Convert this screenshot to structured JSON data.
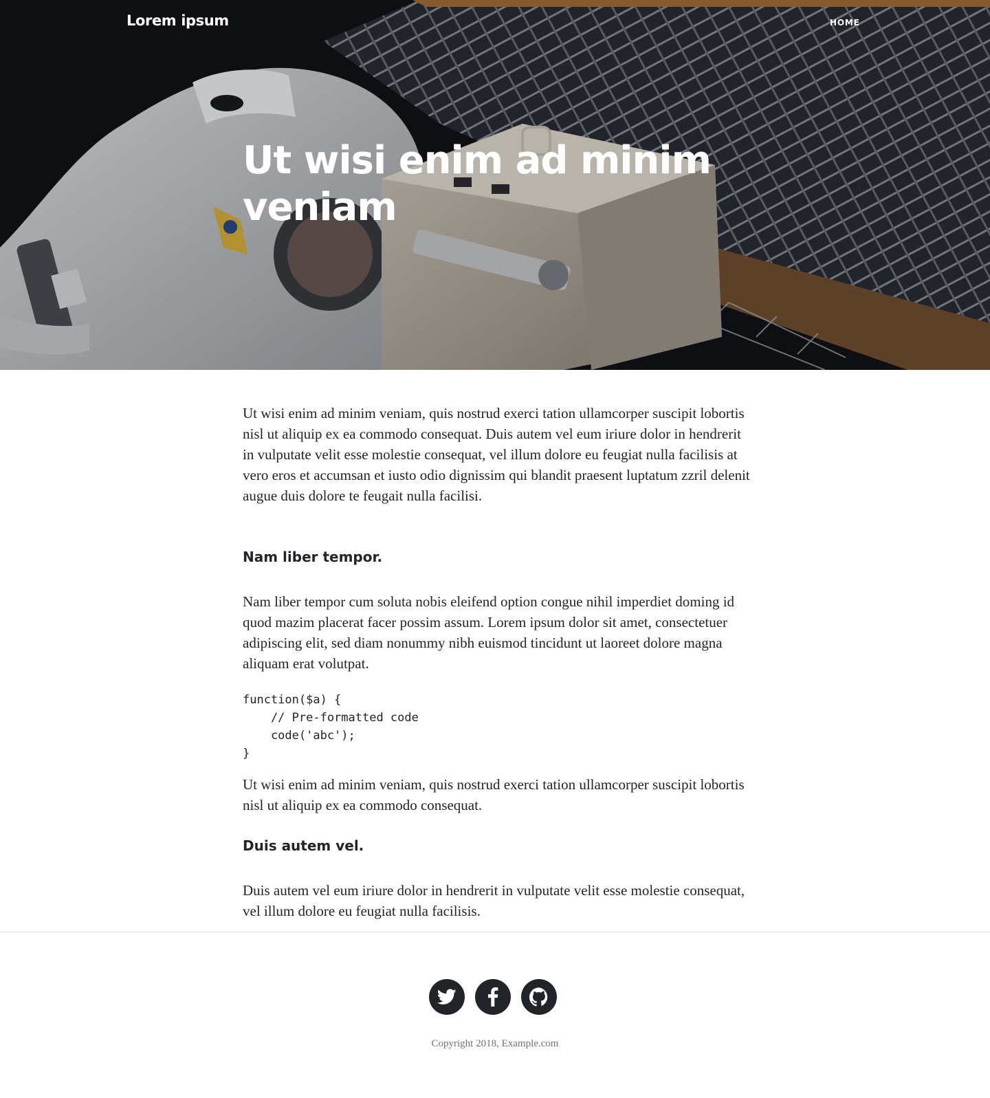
{
  "nav": {
    "brand": "Lorem ipsum",
    "home": "HOME"
  },
  "hero": {
    "title": "Ut wisi enim ad minim veniam"
  },
  "article": {
    "paragraph_1": "Ut wisi enim ad minim veniam, quis nostrud exerci tation ullamcorper suscipit lobortis nisl ut aliquip ex ea commodo consequat. Duis autem vel eum iriure dolor in hendrerit in vulputate velit esse molestie consequat, vel illum dolore eu feugiat nulla facilisis at vero eros et accumsan et iusto odio dignissim qui blandit praesent luptatum zzril delenit augue duis dolore te feugait nulla facilisi.",
    "heading_1": "Nam liber tempor.",
    "paragraph_2": "Nam liber tempor cum soluta nobis eleifend option congue nihil imperdiet doming id quod mazim placerat facer possim assum. Lorem ipsum dolor sit amet, consectetuer adipiscing elit, sed diam nonummy nibh euismod tincidunt ut laoreet dolore magna aliquam erat volutpat.",
    "code": "function($a) {\n    // Pre-formatted code\n    code('abc');\n}",
    "paragraph_3": "Ut wisi enim ad minim veniam, quis nostrud exerci tation ullamcorper suscipit lobortis nisl ut aliquip ex ea commodo consequat.",
    "heading_2": "Duis autem vel.",
    "paragraph_4": "Duis autem vel eum iriure dolor in hendrerit in vulputate velit esse molestie consequat, vel illum dolore eu feugiat nulla facilisis."
  },
  "footer": {
    "social": [
      {
        "icon": "twitter-icon"
      },
      {
        "icon": "facebook-icon"
      },
      {
        "icon": "github-icon"
      }
    ],
    "copyright": "Copyright 2018, Example.com"
  },
  "colors": {
    "hero_bg": "#121317",
    "text": "#212529",
    "muted": "#6c757d",
    "social_bg": "#212529"
  }
}
